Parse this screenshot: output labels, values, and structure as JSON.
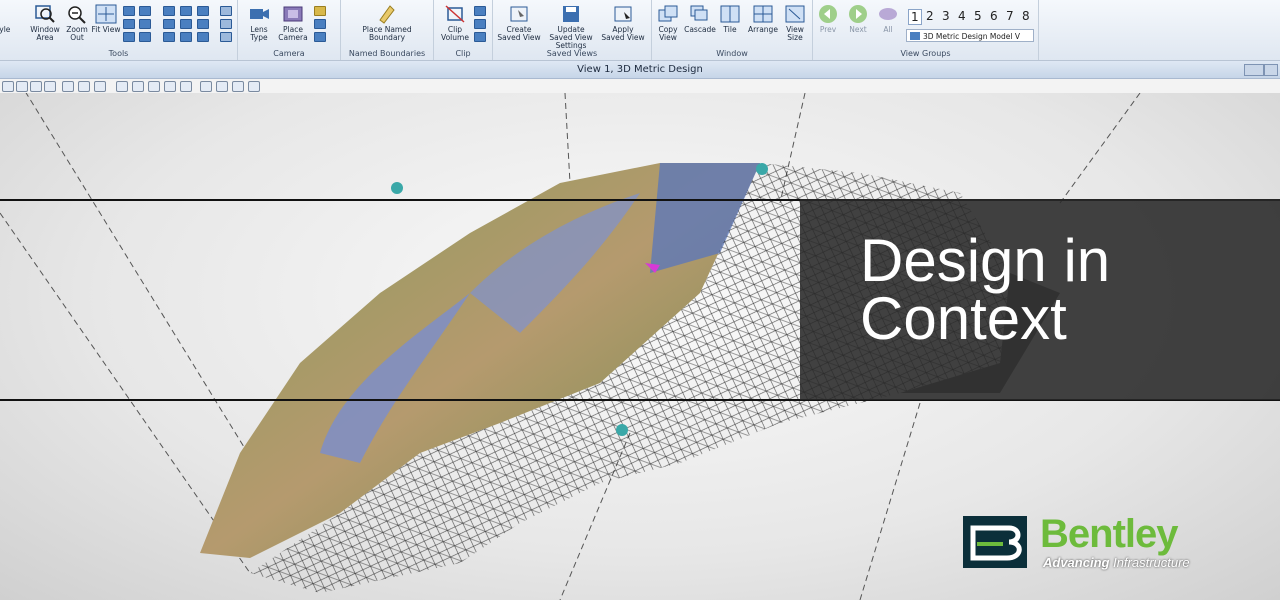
{
  "ribbon": {
    "tools": {
      "label": "Tools",
      "style_label": "Style",
      "window_area": "Window Area",
      "zoom_out": "Zoom Out",
      "fit_view": "Fit View"
    },
    "camera": {
      "label": "Camera",
      "lens_type": "Lens Type",
      "place_camera": "Place Camera"
    },
    "named_boundaries": {
      "label": "Named Boundaries",
      "place": "Place Named Boundary"
    },
    "clip": {
      "label": "Clip",
      "clip_volume": "Clip Volume"
    },
    "saved_views": {
      "label": "Saved Views",
      "create": "Create Saved View",
      "update": "Update Saved View Settings",
      "apply": "Apply Saved View"
    },
    "window": {
      "label": "Window",
      "copy_view": "Copy View",
      "cascade": "Cascade",
      "tile": "Tile",
      "arrange": "Arrange",
      "view_size": "View Size"
    },
    "view_groups": {
      "label": "View Groups",
      "prev": "Prev",
      "next": "Next",
      "all": "All",
      "numbers": [
        "1",
        "2",
        "3",
        "4",
        "5",
        "6",
        "7",
        "8"
      ],
      "active": "1",
      "model_dropdown": "3D Metric Design Model V"
    }
  },
  "view": {
    "title": "View 1, 3D Metric Design"
  },
  "overlay": {
    "line1": "Design in",
    "line2": "Context"
  },
  "logo": {
    "name": "Bentley",
    "tagline_bold": "Advancing",
    "tagline_rest": " Infrastructure"
  },
  "colors": {
    "ribbon_bg": "#e6edf6",
    "accent_blue": "#4a7fc0",
    "bentley_green": "#6dbb3c",
    "overlay_bg": "#2a2a2a"
  }
}
